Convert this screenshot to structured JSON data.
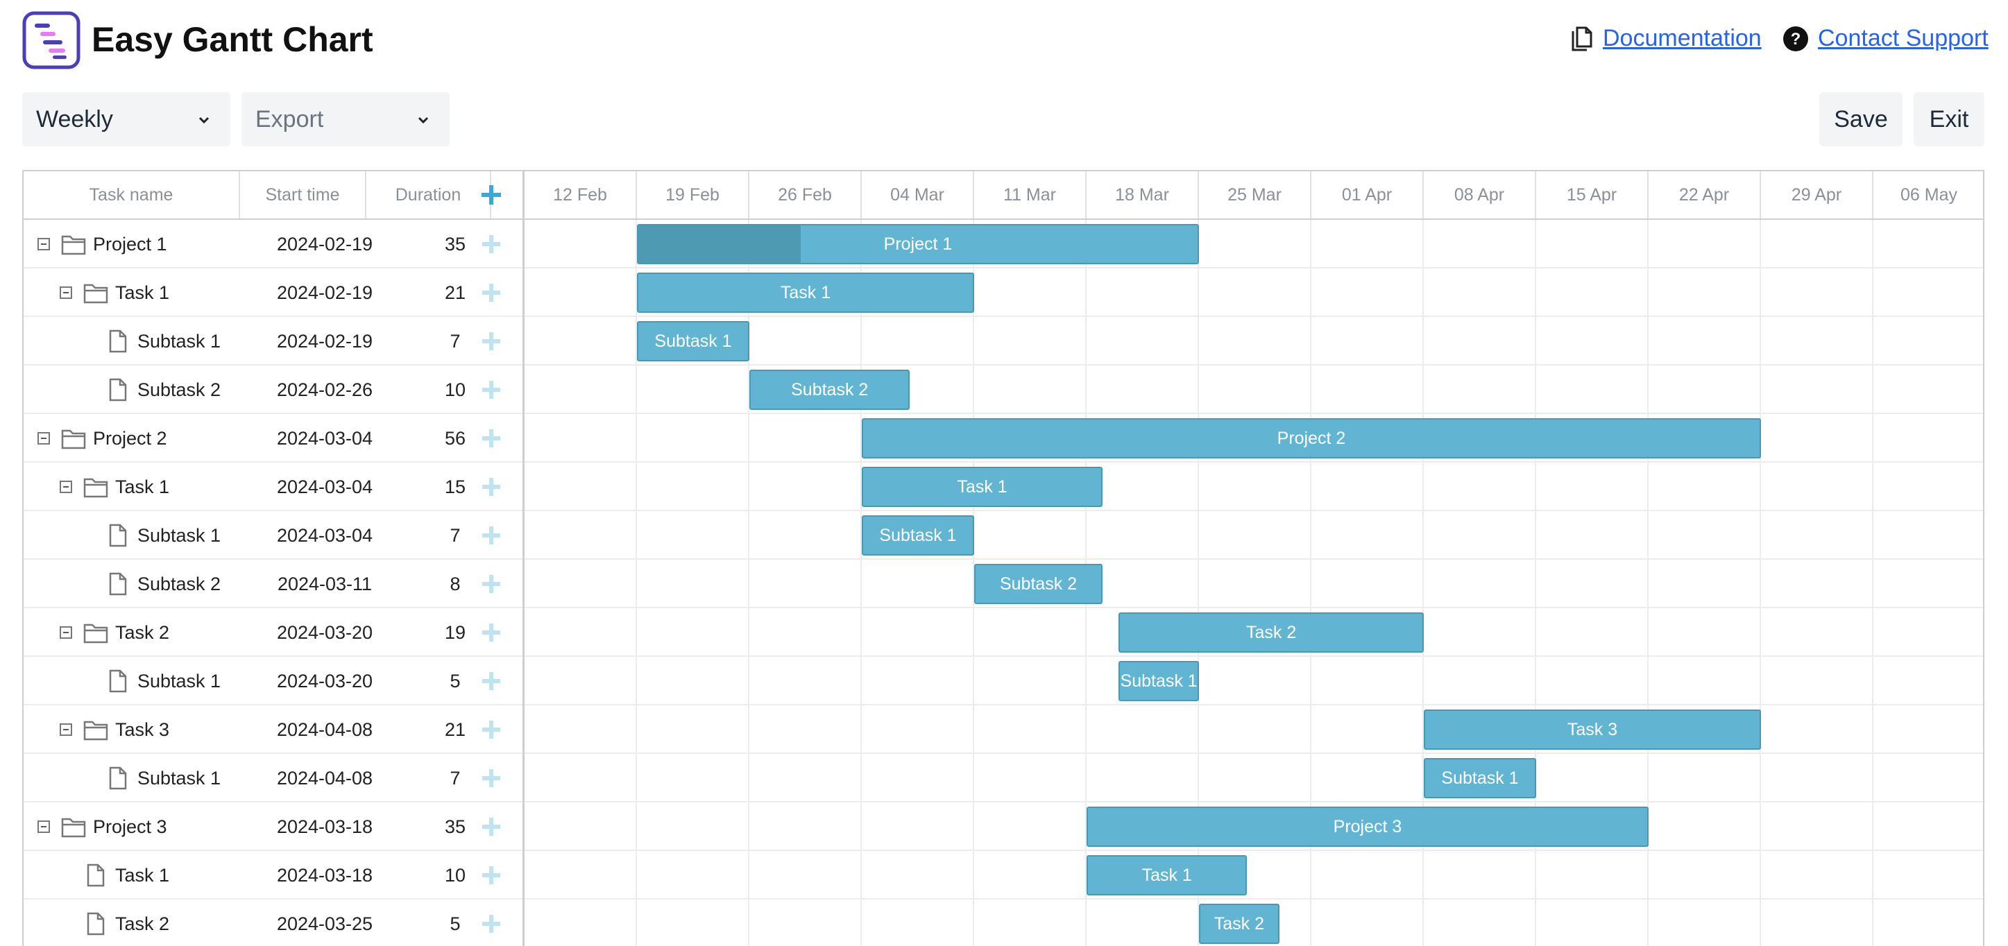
{
  "app": {
    "title": "Easy Gantt Chart",
    "links": {
      "documentation": "Documentation",
      "support": "Contact Support"
    }
  },
  "toolbar": {
    "scale_select": "Weekly",
    "export_select": "Export",
    "save_label": "Save",
    "exit_label": "Exit"
  },
  "columns": {
    "task_name": "Task name",
    "start_time": "Start time",
    "duration": "Duration"
  },
  "scale": [
    "12 Feb",
    "19 Feb",
    "26 Feb",
    "04 Mar",
    "11 Mar",
    "18 Mar",
    "25 Mar",
    "01 Apr",
    "08 Apr",
    "15 Apr",
    "22 Apr",
    "29 Apr",
    "06 May"
  ],
  "chart_origin": "2024-02-12",
  "colors": {
    "bar": "#62b5d2",
    "bar_border": "#4a97b2",
    "progress": "#4e9ab3"
  },
  "tasks": [
    {
      "name": "Project 1",
      "start": "2024-02-19",
      "duration": 35,
      "level": 0,
      "type": "folder",
      "expanded": true,
      "progress": 0.29
    },
    {
      "name": "Task 1",
      "start": "2024-02-19",
      "duration": 21,
      "level": 1,
      "type": "folder",
      "expanded": true
    },
    {
      "name": "Subtask 1",
      "start": "2024-02-19",
      "duration": 7,
      "level": 2,
      "type": "file"
    },
    {
      "name": "Subtask 2",
      "start": "2024-02-26",
      "duration": 10,
      "level": 2,
      "type": "file"
    },
    {
      "name": "Project 2",
      "start": "2024-03-04",
      "duration": 56,
      "level": 0,
      "type": "folder",
      "expanded": true
    },
    {
      "name": "Task 1",
      "start": "2024-03-04",
      "duration": 15,
      "level": 1,
      "type": "folder",
      "expanded": true
    },
    {
      "name": "Subtask 1",
      "start": "2024-03-04",
      "duration": 7,
      "level": 2,
      "type": "file"
    },
    {
      "name": "Subtask 2",
      "start": "2024-03-11",
      "duration": 8,
      "level": 2,
      "type": "file"
    },
    {
      "name": "Task 2",
      "start": "2024-03-20",
      "duration": 19,
      "level": 1,
      "type": "folder",
      "expanded": true
    },
    {
      "name": "Subtask 1",
      "start": "2024-03-20",
      "duration": 5,
      "level": 2,
      "type": "file"
    },
    {
      "name": "Task 3",
      "start": "2024-04-08",
      "duration": 21,
      "level": 1,
      "type": "folder",
      "expanded": true
    },
    {
      "name": "Subtask 1",
      "start": "2024-04-08",
      "duration": 7,
      "level": 2,
      "type": "file"
    },
    {
      "name": "Project 3",
      "start": "2024-03-18",
      "duration": 35,
      "level": 0,
      "type": "folder",
      "expanded": true
    },
    {
      "name": "Task 1",
      "start": "2024-03-18",
      "duration": 10,
      "level": 1,
      "type": "file"
    },
    {
      "name": "Task 2",
      "start": "2024-03-25",
      "duration": 5,
      "level": 1,
      "type": "file"
    }
  ]
}
